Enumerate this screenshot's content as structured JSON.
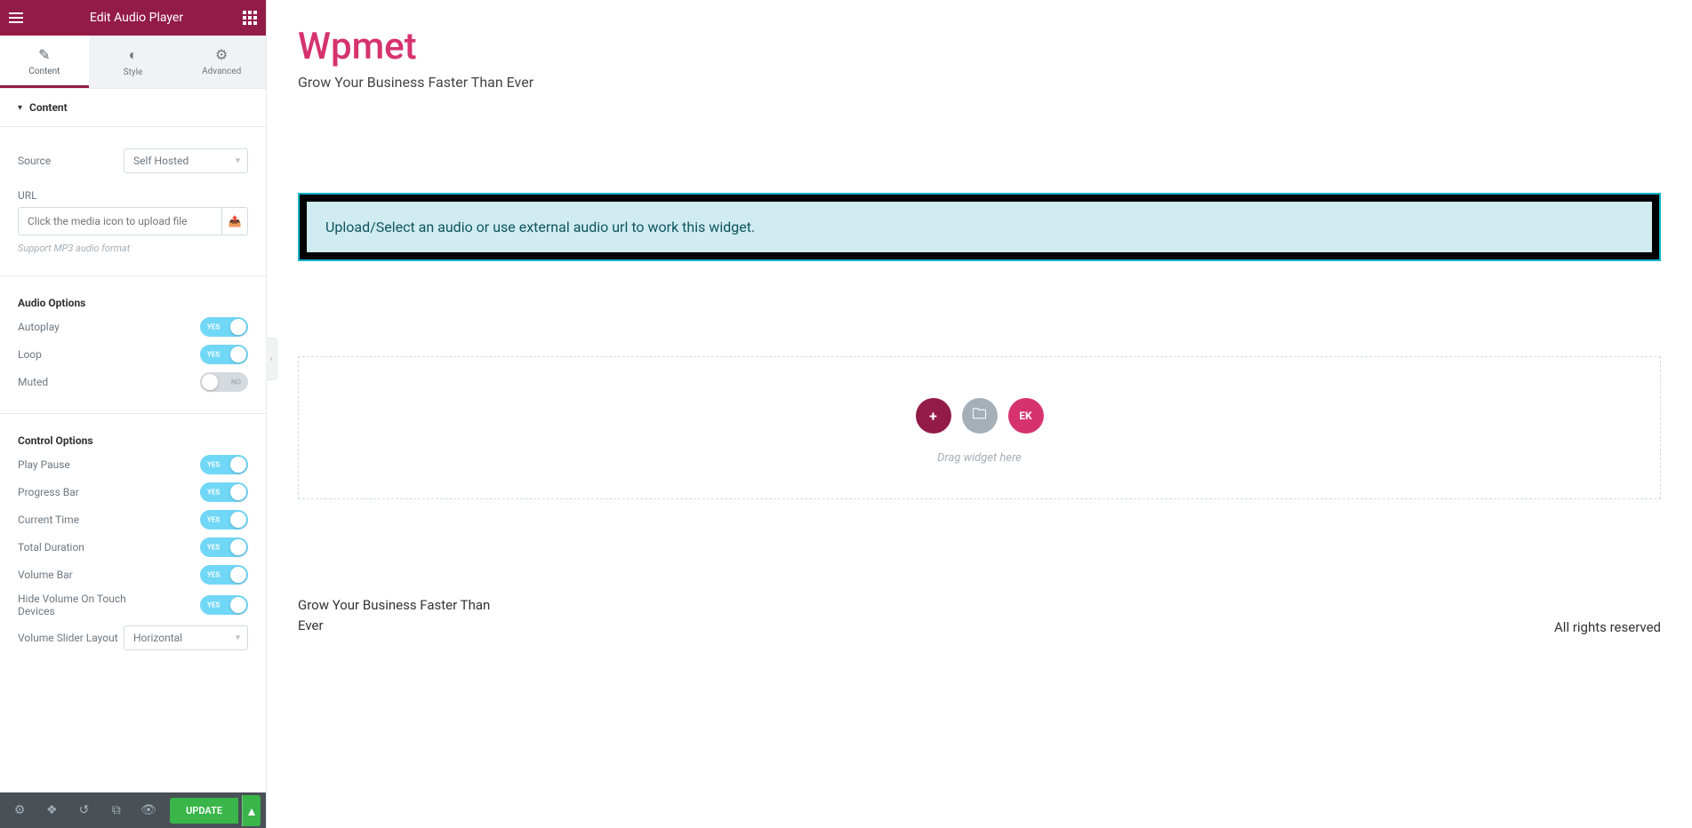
{
  "header": {
    "title": "Edit Audio Player"
  },
  "tabs": {
    "content": "Content",
    "style": "Style",
    "advanced": "Advanced"
  },
  "section": {
    "content_label": "Content"
  },
  "source": {
    "label": "Source",
    "value": "Self Hosted"
  },
  "url": {
    "label": "URL",
    "placeholder": "Click the media icon to upload file",
    "help": "Support MP3 audio format"
  },
  "audio_options": {
    "heading": "Audio Options",
    "autoplay": {
      "label": "Autoplay",
      "state": "YES"
    },
    "loop": {
      "label": "Loop",
      "state": "YES"
    },
    "muted": {
      "label": "Muted",
      "state": "NO"
    }
  },
  "control_options": {
    "heading": "Control Options",
    "play_pause": {
      "label": "Play Pause",
      "state": "YES"
    },
    "progress_bar": {
      "label": "Progress Bar",
      "state": "YES"
    },
    "current_time": {
      "label": "Current Time",
      "state": "YES"
    },
    "total_duration": {
      "label": "Total Duration",
      "state": "YES"
    },
    "volume_bar": {
      "label": "Volume Bar",
      "state": "YES"
    },
    "hide_volume": {
      "label": "Hide Volume On Touch Devices",
      "state": "YES"
    },
    "slider_layout": {
      "label": "Volume Slider Layout",
      "value": "Horizontal"
    }
  },
  "bottom_bar": {
    "update": "UPDATE"
  },
  "canvas": {
    "site_title": "Wpmet",
    "tagline": "Grow Your Business Faster Than Ever",
    "widget_msg": "Upload/Select an audio or use external audio url to work this widget.",
    "drag_hint": "Drag widget here",
    "template_label": "EK",
    "footer_left": "Grow Your Business Faster Than Ever",
    "footer_right": "All rights reserved"
  }
}
